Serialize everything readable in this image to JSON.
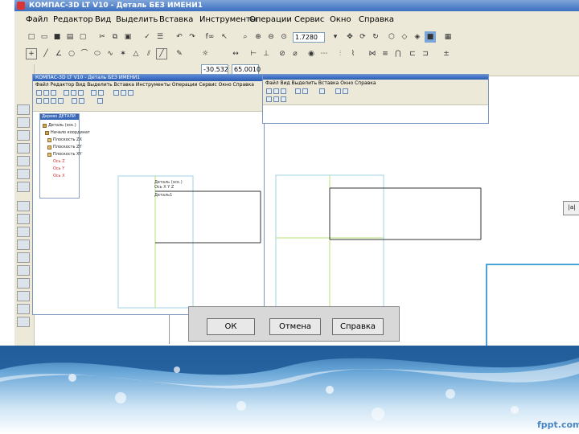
{
  "window": {
    "title": "КОМПАС-3D LT V10 - Деталь БЕЗ ИМЕНИ1"
  },
  "menu": [
    "Файл",
    "Редактор",
    "Вид",
    "Выделить",
    "Вставка",
    "Инструменты",
    "Операции",
    "Сервис",
    "Окно",
    "Справка"
  ],
  "toolbar": {
    "zoom_value": "1.7280",
    "coord_x": "-30.532",
    "coord_y": "65.0010"
  },
  "sub_window_left": {
    "title": "КОМПАС-3D LT V10 - Деталь БЕЗ ИМЕНИ1",
    "menu": "Файл  Редактор  Вид  Выделить  Вставка  Инструменты  Операции  Сервис  Окно  Справка",
    "tree": {
      "title": "Дерево ДЕТАЛИ",
      "items": [
        "Деталь (эск.)",
        "Начало координат",
        "Плоскость ZX",
        "Плоскость ZY",
        "Плоскость XY",
        "Ось Z",
        "Ось Y",
        "Ось X"
      ]
    },
    "sketch_labels": [
      "Деталь (эск.)",
      "Ось X Y Z",
      "Деталь1"
    ]
  },
  "sub_window_right": {
    "menu": "Файл  Вид  Выделить  Вставка  Окно  Справка"
  },
  "dialog": {
    "ok": "ОК",
    "cancel": "Отмена",
    "help": "Справка"
  },
  "watermark": "fppt.com"
}
